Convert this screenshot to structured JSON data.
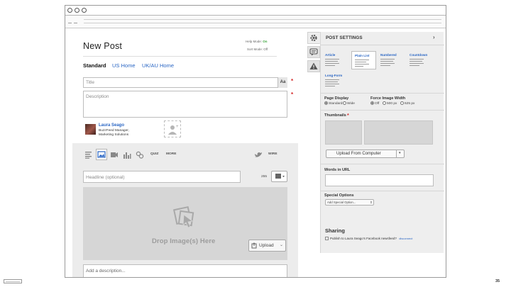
{
  "page": {
    "title": "New Post",
    "help_mode_label": "Help Mode:",
    "help_mode_value": "On",
    "sort_mode_label": "Sort Mode:",
    "sort_mode_value": "Off",
    "slide_number": "35"
  },
  "edition_tabs": [
    {
      "label": "Standard",
      "active": true
    },
    {
      "label": "US Home",
      "active": false
    },
    {
      "label": "UK/AU Home",
      "active": false
    }
  ],
  "fields": {
    "title_placeholder": "Title",
    "description_placeholder": "Description",
    "format_button": "Aa",
    "required_mark": "*"
  },
  "author": {
    "name": "Laura Seago",
    "role_line1": "BuzzFeed Manager,",
    "role_line2": "Marketing Solutions"
  },
  "block_toolbar": {
    "icons": [
      "text-icon",
      "image-icon",
      "video-icon",
      "chart-icon",
      "link-icon"
    ],
    "quiz_label": "QUIZ",
    "more_label": "MORE",
    "wire_label": "WIRE",
    "twitter_icon": "twitter-icon"
  },
  "image_block": {
    "headline_placeholder": "Headline (optional)",
    "char_count": "255",
    "drop_label": "Drop Image(s) Here",
    "upload_label": "Upload",
    "description_placeholder": "Add a description..."
  },
  "settings": {
    "title": "POST SETTINGS",
    "formats": [
      {
        "label": "Article",
        "active": false
      },
      {
        "label": "Plain List",
        "active": true
      },
      {
        "label": "Numbered",
        "active": false
      },
      {
        "label": "Countdown",
        "active": false
      },
      {
        "label": "Long-Form",
        "active": false
      }
    ],
    "page_display_label": "Page Display",
    "page_display_options": [
      {
        "label": "Standard",
        "selected": true
      },
      {
        "label": "Wide",
        "selected": false
      }
    ],
    "force_width_label": "Force Image Width",
    "force_width_options": [
      {
        "label": "Off",
        "selected": true
      },
      {
        "label": "500 px",
        "selected": false
      },
      {
        "label": "625 px",
        "selected": false
      }
    ],
    "thumbnails_label": "Thumbnails",
    "upload_from_computer": "Upload From Computer",
    "words_in_url_label": "Words in URL",
    "special_options_label": "Special Options",
    "special_options_select": "Add Special Option...",
    "sharing_title": "Sharing",
    "share_facebook": "Publish to Laura Seago's Facebook newsfeed?",
    "share_disconnect": "disconnect"
  },
  "colors": {
    "link": "#2a66c4",
    "required": "#d42a2a",
    "on": "#3aa33a"
  }
}
